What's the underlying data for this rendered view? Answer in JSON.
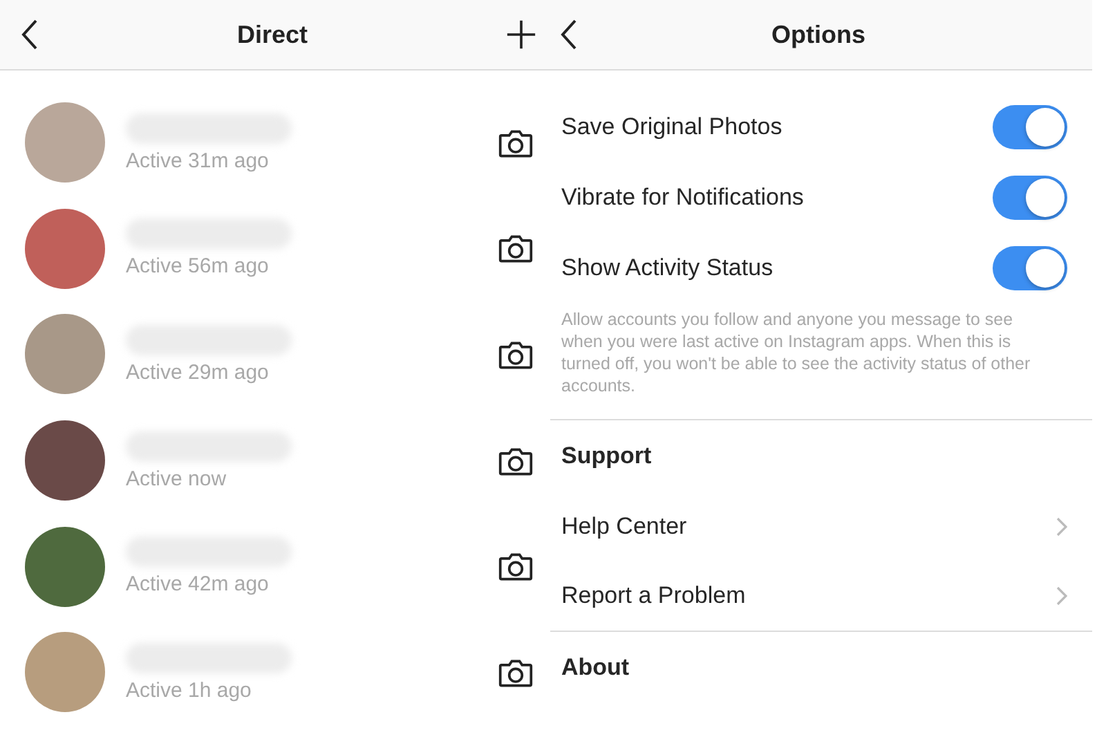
{
  "direct": {
    "title": "Direct",
    "conversations": [
      {
        "status": "Active 31m ago"
      },
      {
        "status": "Active 56m ago"
      },
      {
        "status": "Active 29m ago"
      },
      {
        "status": "Active now"
      },
      {
        "status": "Active 42m ago"
      },
      {
        "status": "Active 1h ago"
      }
    ]
  },
  "options": {
    "title": "Options",
    "items": [
      {
        "kind": "toggle",
        "label": "Save Original Photos",
        "on": true
      },
      {
        "kind": "toggle",
        "label": "Vibrate for Notifications",
        "on": true
      },
      {
        "kind": "toggle",
        "label": "Show Activity Status",
        "on": true
      },
      {
        "kind": "note",
        "text": "Allow accounts you follow and anyone you message to see when you were last active on Instagram apps. When this is turned off, you won't be able to see the activity status of other accounts."
      },
      {
        "kind": "section",
        "label": "Support"
      },
      {
        "kind": "link",
        "label": "Help Center"
      },
      {
        "kind": "link",
        "label": "Report a Problem"
      },
      {
        "kind": "section",
        "label": "About"
      }
    ]
  }
}
